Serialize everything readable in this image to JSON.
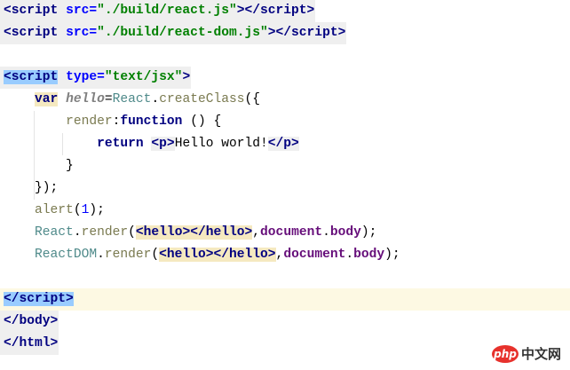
{
  "editor": {
    "lines": [
      {
        "bg": "grey",
        "tokens": [
          {
            "t": "<script ",
            "c": "tag"
          },
          {
            "t": "src=",
            "c": "attr"
          },
          {
            "t": "\"./build/react.js\"",
            "c": "str"
          },
          {
            "t": "></script>",
            "c": "tag"
          }
        ]
      },
      {
        "bg": "grey",
        "tokens": [
          {
            "t": "<script ",
            "c": "tag"
          },
          {
            "t": "src=",
            "c": "attr"
          },
          {
            "t": "\"./build/react-dom.js\"",
            "c": "str"
          },
          {
            "t": "></script>",
            "c": "tag"
          }
        ]
      },
      {
        "bg": "",
        "tokens": []
      },
      {
        "bg": "grey",
        "tokens": [
          {
            "t": "<script",
            "c": "tag hlblue"
          },
          {
            "t": " type=",
            "c": "attr"
          },
          {
            "t": "\"text/jsx\"",
            "c": "str"
          },
          {
            "t": ">",
            "c": "tag"
          }
        ]
      },
      {
        "bg": "",
        "tokens": [
          {
            "t": "    ",
            "c": "plain"
          },
          {
            "t": "var",
            "c": "kw hlyel"
          },
          {
            "t": " ",
            "c": "plain"
          },
          {
            "t": "hello",
            "c": "ital"
          },
          {
            "t": "=",
            "c": "plain"
          },
          {
            "t": "React",
            "c": "obj"
          },
          {
            "t": ".",
            "c": "plain"
          },
          {
            "t": "createClass",
            "c": "fn"
          },
          {
            "t": "({",
            "c": "plain"
          }
        ]
      },
      {
        "bg": "",
        "tokens": [
          {
            "t": "        ",
            "c": "plain"
          },
          {
            "t": "render",
            "c": "fn"
          },
          {
            "t": ":",
            "c": "plain"
          },
          {
            "t": "function",
            "c": "kw"
          },
          {
            "t": " () {",
            "c": "plain"
          }
        ]
      },
      {
        "bg": "",
        "tokens": [
          {
            "t": "            ",
            "c": "plain"
          },
          {
            "t": "return",
            "c": "kw"
          },
          {
            "t": " ",
            "c": "plain"
          },
          {
            "t": "<p>",
            "c": "tag hlgrey"
          },
          {
            "t": "Hello world!",
            "c": "plain"
          },
          {
            "t": "</p>",
            "c": "tag hlgrey"
          }
        ]
      },
      {
        "bg": "",
        "tokens": [
          {
            "t": "        }",
            "c": "plain"
          }
        ]
      },
      {
        "bg": "",
        "tokens": [
          {
            "t": "    });",
            "c": "plain"
          }
        ]
      },
      {
        "bg": "",
        "tokens": [
          {
            "t": "    ",
            "c": "plain"
          },
          {
            "t": "alert",
            "c": "fn"
          },
          {
            "t": "(",
            "c": "plain"
          },
          {
            "t": "1",
            "c": "num"
          },
          {
            "t": ");",
            "c": "plain"
          }
        ]
      },
      {
        "bg": "",
        "tokens": [
          {
            "t": "    ",
            "c": "plain"
          },
          {
            "t": "React",
            "c": "obj"
          },
          {
            "t": ".",
            "c": "plain"
          },
          {
            "t": "render",
            "c": "fn"
          },
          {
            "t": "(",
            "c": "plain"
          },
          {
            "t": "<hello></hello>",
            "c": "tag hlyel"
          },
          {
            "t": ",",
            "c": "plain"
          },
          {
            "t": "document",
            "c": "prop"
          },
          {
            "t": ".",
            "c": "plain"
          },
          {
            "t": "body",
            "c": "prop"
          },
          {
            "t": ");",
            "c": "plain"
          }
        ]
      },
      {
        "bg": "",
        "tokens": [
          {
            "t": "    ",
            "c": "plain"
          },
          {
            "t": "ReactDOM",
            "c": "obj"
          },
          {
            "t": ".",
            "c": "plain"
          },
          {
            "t": "render",
            "c": "fn"
          },
          {
            "t": "(",
            "c": "plain"
          },
          {
            "t": "<hello></hello>",
            "c": "tag hlyel"
          },
          {
            "t": ",",
            "c": "plain"
          },
          {
            "t": "document",
            "c": "prop"
          },
          {
            "t": ".",
            "c": "plain"
          },
          {
            "t": "body",
            "c": "prop"
          },
          {
            "t": ");",
            "c": "plain"
          }
        ]
      },
      {
        "bg": "",
        "tokens": []
      },
      {
        "bg": "curline",
        "tokens": [
          {
            "t": "</script>",
            "c": "tag hlblue"
          }
        ]
      },
      {
        "bg": "grey",
        "tokens": [
          {
            "t": "</body>",
            "c": "tag"
          }
        ]
      },
      {
        "bg": "grey",
        "tokens": [
          {
            "t": "</html>",
            "c": "tag"
          }
        ]
      }
    ]
  },
  "watermark": {
    "logo": "php",
    "text": "中文网"
  }
}
